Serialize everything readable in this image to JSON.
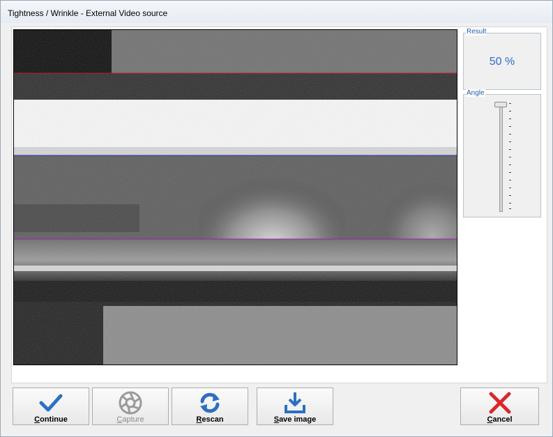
{
  "window": {
    "title": "Tightness / Wrinkle - External Video source"
  },
  "result": {
    "label": "Result",
    "value": "50 %"
  },
  "angle": {
    "label": "Angle",
    "level": 0.0
  },
  "buttons": [
    {
      "id": "continue",
      "mnemonic": "C",
      "rest": "ontinue",
      "icon": "checkmark-icon",
      "enabled": true
    },
    {
      "id": "capture",
      "mnemonic": "C",
      "rest": "apture",
      "icon": "aperture-icon",
      "enabled": false
    },
    {
      "id": "rescan",
      "mnemonic": "R",
      "rest": "escan",
      "icon": "refresh-icon",
      "enabled": true
    },
    {
      "id": "save",
      "mnemonic": "S",
      "rest": "ave image",
      "icon": "download-icon",
      "enabled": true
    },
    {
      "id": "cancel",
      "mnemonic": "C",
      "rest": "ancel",
      "icon": "close-icon",
      "enabled": true
    }
  ],
  "colors": {
    "accent": "#2a6fc4",
    "cancel": "#d8282b",
    "line_red": "#b0202a",
    "line_blue": "#2830b0",
    "line_purple": "#9020a0"
  }
}
